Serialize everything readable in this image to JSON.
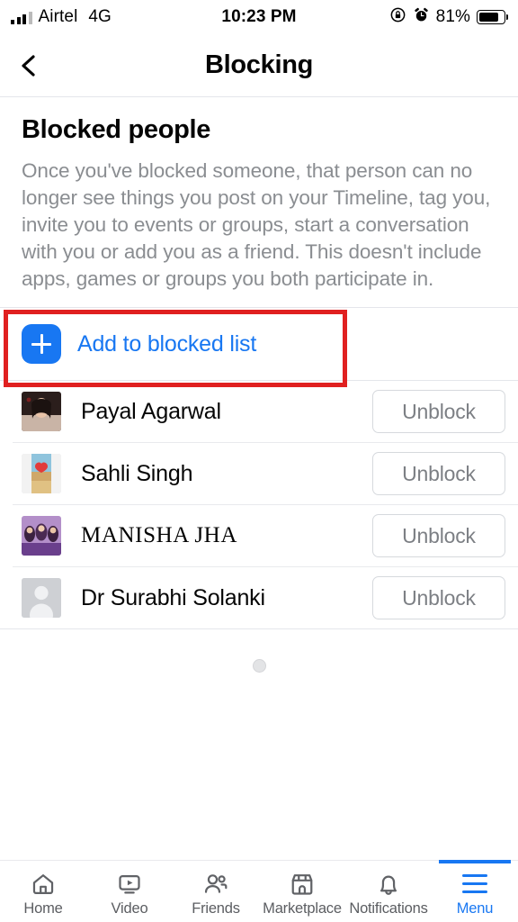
{
  "status_bar": {
    "carrier": "Airtel",
    "network": "4G",
    "time": "10:23 PM",
    "battery_percent": "81%",
    "icons": [
      "signal-bars-icon",
      "rotation-lock-icon",
      "alarm-clock-icon",
      "battery-icon"
    ]
  },
  "header": {
    "back_icon": "chevron-left-icon",
    "title": "Blocking"
  },
  "section": {
    "title": "Blocked people",
    "description": "Once you've blocked someone, that person can no longer see things you post on your Timeline, tag you, invite you to events or groups, start a conversation with you or add you as a friend. This doesn't include apps, games or groups you both participate in."
  },
  "add_row": {
    "icon": "plus-icon",
    "label": "Add to blocked list",
    "accent_color": "#1877F2",
    "highlight_color": "#E02020"
  },
  "blocked_people": [
    {
      "name": "Payal Agarwal",
      "avatar": "photo-portrait",
      "action_label": "Unblock",
      "name_style": "sans"
    },
    {
      "name": "Sahli Singh",
      "avatar": "photo-beach-heart",
      "action_label": "Unblock",
      "name_style": "sans"
    },
    {
      "name": "MANISHA JHA",
      "avatar": "photo-group",
      "action_label": "Unblock",
      "name_style": "serif"
    },
    {
      "name": "Dr Surabhi Solanki",
      "avatar": "default-silhouette",
      "action_label": "Unblock",
      "name_style": "sans"
    }
  ],
  "loading": {
    "indicator": "loading-spinner"
  },
  "tabbar": {
    "active": "Menu",
    "items": [
      {
        "label": "Home",
        "icon": "home-icon",
        "active": false
      },
      {
        "label": "Video",
        "icon": "video-icon",
        "active": false
      },
      {
        "label": "Friends",
        "icon": "friends-icon",
        "active": false
      },
      {
        "label": "Marketplace",
        "icon": "marketplace-icon",
        "active": false
      },
      {
        "label": "Notifications",
        "icon": "bell-icon",
        "active": false
      },
      {
        "label": "Menu",
        "icon": "hamburger-icon",
        "active": true
      }
    ]
  }
}
